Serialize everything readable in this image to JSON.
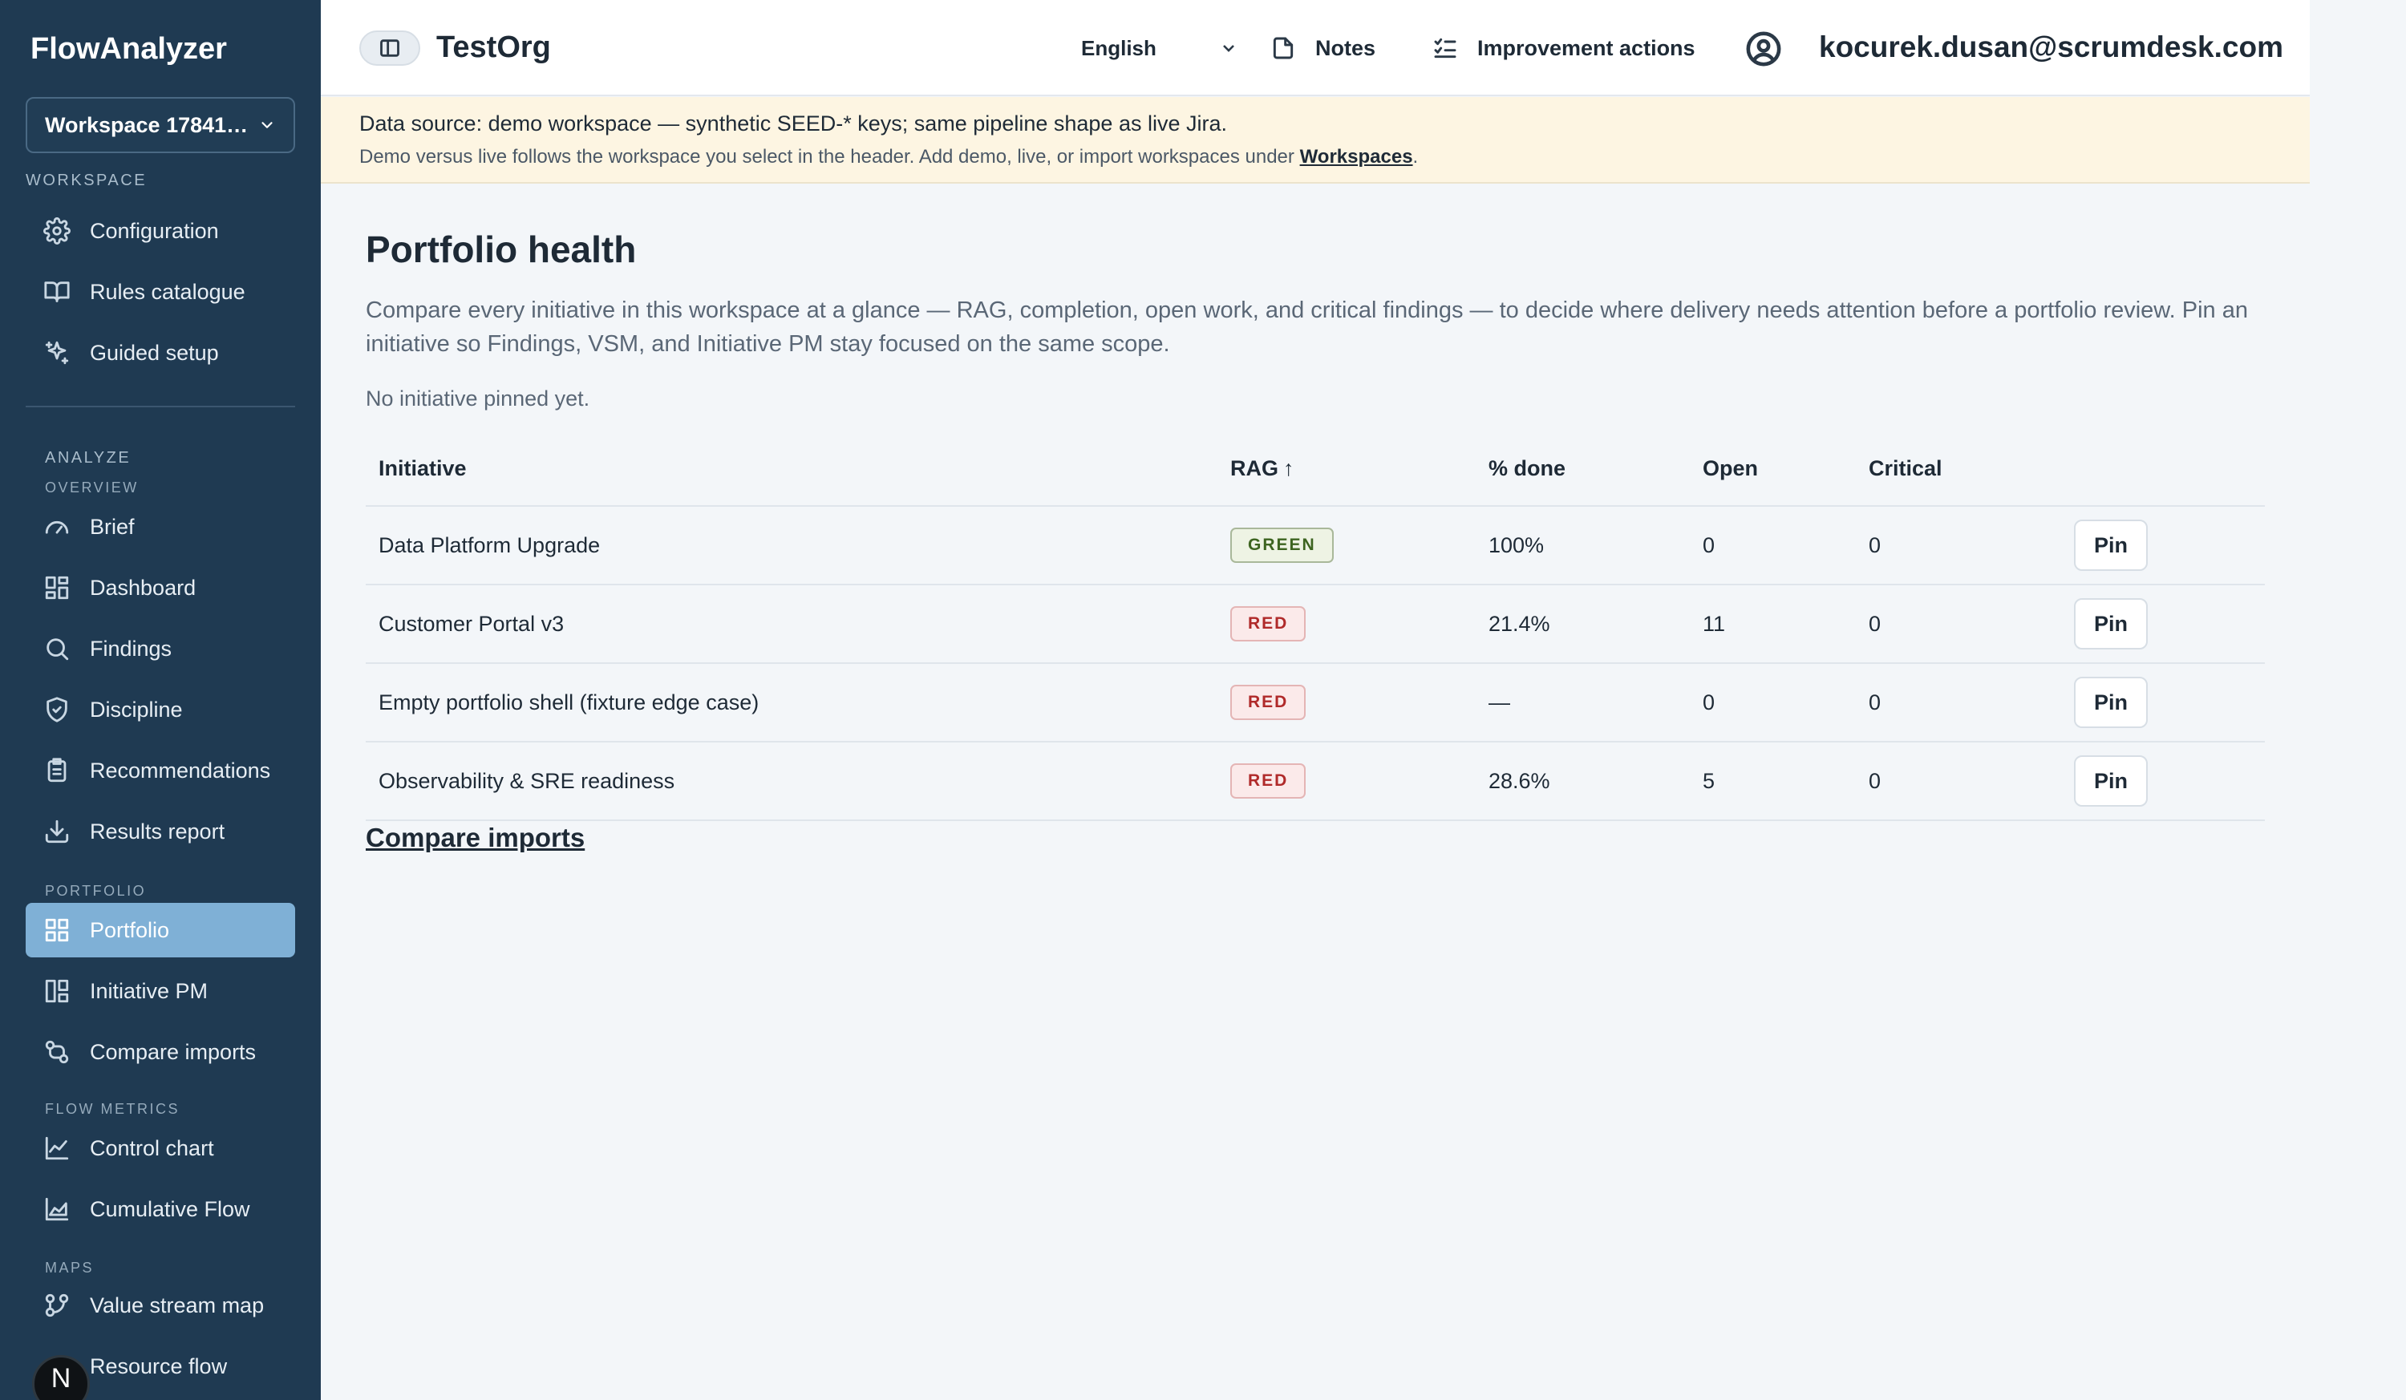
{
  "sidebar": {
    "brand": "FlowAnalyzer",
    "workspace_selector": "Workspace 17841…",
    "sections": {
      "workspace": "WORKSPACE",
      "analyze": "ANALYZE",
      "overview": "OVERVIEW",
      "portfolio": "PORTFOLIO",
      "flow_metrics": "FLOW METRICS",
      "maps": "MAPS"
    },
    "items": {
      "configuration": "Configuration",
      "rules_catalogue": "Rules catalogue",
      "guided_setup": "Guided setup",
      "brief": "Brief",
      "dashboard": "Dashboard",
      "findings": "Findings",
      "discipline": "Discipline",
      "recommendations": "Recommendations",
      "results_report": "Results report",
      "portfolio": "Portfolio",
      "initiative_pm": "Initiative PM",
      "compare_imports": "Compare imports",
      "control_chart": "Control chart",
      "cumulative_flow": "Cumulative Flow",
      "value_stream_map": "Value stream map",
      "resource_flow": "Resource flow"
    },
    "active_item": "portfolio",
    "badge_letter": "N"
  },
  "header": {
    "org": "TestOrg",
    "language": "English",
    "notes": "Notes",
    "improvement_actions": "Improvement actions",
    "user_email": "kocurek.dusan@scrumdesk.com"
  },
  "banner": {
    "line1": "Data source: demo workspace — synthetic SEED-* keys; same pipeline shape as live Jira.",
    "line2_prefix": "Demo versus live follows the workspace you select in the header. Add demo, live, or import workspaces under ",
    "line2_link": "Workspaces",
    "line2_suffix": "."
  },
  "main": {
    "title": "Portfolio health",
    "description": "Compare every initiative in this workspace at a glance — RAG, completion, open work, and critical findings — to decide where delivery needs attention before a portfolio review. Pin an initiative so Findings, VSM, and Initiative PM stay focused on the same scope.",
    "pinned_status": "No initiative pinned yet.",
    "compare_link": "Compare imports"
  },
  "table": {
    "columns": {
      "initiative": "Initiative",
      "rag": "RAG",
      "rag_sort": "↑",
      "done": "% done",
      "open": "Open",
      "critical": "Critical"
    },
    "pin_label": "Pin",
    "rows": [
      {
        "initiative": "Data Platform Upgrade",
        "rag": "GREEN",
        "done": "100%",
        "open": "0",
        "critical": "0"
      },
      {
        "initiative": "Customer Portal v3",
        "rag": "RED",
        "done": "21.4%",
        "open": "11",
        "critical": "0"
      },
      {
        "initiative": "Empty portfolio shell (fixture edge case)",
        "rag": "RED",
        "done": "—",
        "open": "0",
        "critical": "0"
      },
      {
        "initiative": "Observability & SRE readiness",
        "rag": "RED",
        "done": "28.6%",
        "open": "5",
        "critical": "0"
      }
    ]
  },
  "colors": {
    "sidebar_bg": "#1f3a52",
    "active_nav": "#7fb0d6",
    "banner_bg": "#fdf5e2",
    "rag_green": "#3d6420",
    "rag_red": "#b02a2a"
  }
}
